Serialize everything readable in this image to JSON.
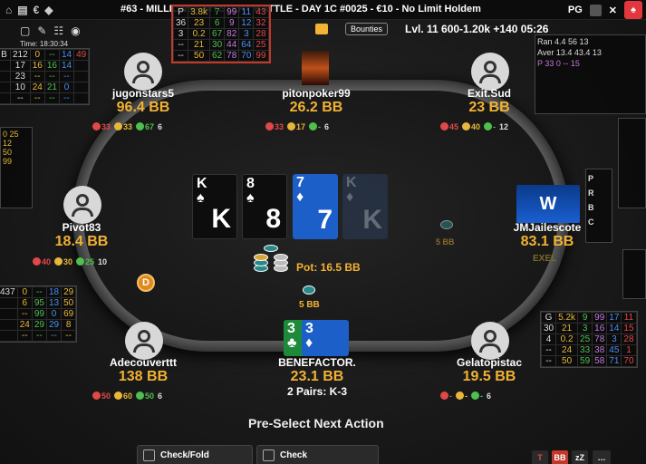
{
  "topbar": {
    "title": "#63 - MILLIONS® MYSTERY BATTLE - DAY 1C #0025 - €10 - No Limit Holdem",
    "pg": "PG"
  },
  "header": {
    "time": "Time: 18:30:34",
    "bounties": "Bounties",
    "level": "Lvl. 11  600-1.20k +140 05:26"
  },
  "hud_top": {
    "rows": [
      [
        "P",
        "3.8k",
        "7",
        "99",
        "11",
        "43"
      ],
      [
        "36",
        "23",
        "6",
        "9",
        "12",
        "32"
      ],
      [
        "3",
        "0.2",
        "67",
        "82",
        "3",
        "28"
      ],
      [
        "--",
        "21",
        "30",
        "44",
        "64",
        "25"
      ],
      [
        "--",
        "50",
        "62",
        "78",
        "70",
        "99"
      ]
    ]
  },
  "players": [
    {
      "name": "jugonstars5",
      "stack": "96.4 BB",
      "s1": "33",
      "s2": "33",
      "s3": "67",
      "s4": "6"
    },
    {
      "name": "pitonpoker99",
      "stack": "26.2 BB",
      "s1": "33",
      "s2": "17",
      "s3": "-",
      "s4": "6"
    },
    {
      "name": "Exit.Sud",
      "stack": "23 BB",
      "s1": "45",
      "s2": "40",
      "s3": "-",
      "s4": "12"
    },
    {
      "name": "Pivot83",
      "stack": "18.4 BB",
      "s1": "40",
      "s2": "30",
      "s3": "25",
      "s4": "10"
    },
    {
      "name": "JMJailescote",
      "stack": "83.1 BB",
      "extra": "EXEL"
    },
    {
      "name": "Adecouverttt",
      "stack": "138 BB",
      "s1": "50",
      "s2": "60",
      "s3": "50",
      "s4": "6"
    },
    {
      "name": "BENEFACTOR.",
      "stack": "23.1 BB",
      "hand": "2 Pairs: K-3"
    },
    {
      "name": "Gelatopistac",
      "stack": "19.5 BB",
      "s1": "-",
      "s2": "-",
      "s3": "-",
      "s4": "6"
    }
  ],
  "board": [
    {
      "rank": "K",
      "suit": "♠",
      "style": "black"
    },
    {
      "rank": "8",
      "suit": "♠",
      "style": "black"
    },
    {
      "rank": "7",
      "suit": "♦",
      "style": "blue"
    },
    {
      "rank": "K",
      "suit": "♦",
      "style": "fade"
    }
  ],
  "hero_cards": [
    {
      "rank": "3",
      "suit": "♣",
      "style": "green"
    },
    {
      "rank": "3",
      "suit": "♦",
      "style": "blue"
    }
  ],
  "pot": "Pot: 16.5 BB",
  "hero_bet": "5 BB",
  "right_bet": "5 BB",
  "dealer": "D",
  "preselect": "Pre-Select Next Action",
  "actions": {
    "checkfold": "Check/Fold",
    "check": "Check"
  },
  "hud_left": {
    "rows": [
      [
        "B",
        "212",
        "0",
        "--",
        "14",
        "49"
      ],
      [
        "",
        "17",
        "16",
        "16",
        "14",
        ""
      ],
      [
        "",
        "23",
        "--",
        "--",
        "--",
        ""
      ],
      [
        "",
        "10",
        "24",
        "21",
        "0",
        ""
      ],
      [
        "",
        "--",
        "--",
        "--",
        "--",
        ""
      ]
    ]
  },
  "hud_left2": {
    "rows": [
      [
        "437",
        "0",
        "--",
        "18",
        "29"
      ],
      [
        "",
        "6",
        "95",
        "13",
        "50"
      ],
      [
        "",
        "--",
        "99",
        "0",
        "69"
      ],
      [
        "",
        "24",
        "29",
        "29",
        "8"
      ],
      [
        "",
        "--",
        "--",
        "--",
        "--"
      ]
    ]
  },
  "hud_right_top": {
    "lines": [
      "Ran 4.4 56 13",
      "Aver 13.4 43.4 13"
    ]
  },
  "hud_right_low": {
    "rows": [
      [
        "G",
        "5.2k",
        "9",
        "99",
        "17",
        "11"
      ],
      [
        "30",
        "21",
        "3",
        "16",
        "14",
        "15"
      ],
      [
        "4",
        "0.2",
        "25",
        "78",
        "3",
        "28"
      ],
      [
        "--",
        "24",
        "33",
        "38",
        "45",
        "1"
      ],
      [
        "--",
        "50",
        "59",
        "58",
        "71",
        "70"
      ]
    ]
  },
  "colors": {
    "stack": "#f2b233",
    "rail": "#6a6a6a",
    "hud_highlight": "#c0392b"
  }
}
